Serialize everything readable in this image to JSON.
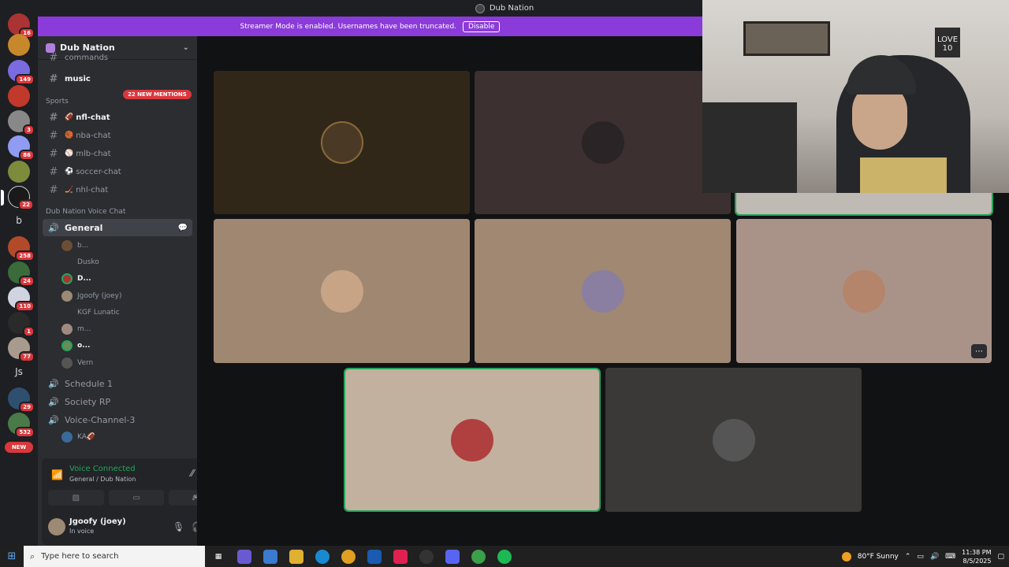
{
  "window": {
    "title": "Dub Nation"
  },
  "banner": {
    "text": "Streamer Mode is enabled. Usernames have been truncated.",
    "disable_label": "Disable"
  },
  "guilds": [
    {
      "badge": "16"
    },
    {
      "badge": ""
    },
    {
      "badge": "149"
    },
    {
      "badge": ""
    },
    {
      "badge": "3"
    },
    {
      "badge": "86"
    },
    {
      "badge": ""
    },
    {
      "badge": "22"
    },
    {
      "letter": "b"
    },
    {
      "badge": "258"
    },
    {
      "badge": "24"
    },
    {
      "badge": "110"
    },
    {
      "badge": "1"
    },
    {
      "badge": "77"
    },
    {
      "letter": "Js"
    },
    {
      "badge": "29"
    },
    {
      "badge": "532"
    }
  ],
  "new_badge": "NEW",
  "server": {
    "name": "Dub Nation"
  },
  "channels": {
    "partial": "commands",
    "music": "music",
    "mentions": "22 NEW MENTIONS",
    "sports_category": "Sports",
    "sports": [
      {
        "name": "nfl-chat",
        "emoji": "🏈",
        "bold": true
      },
      {
        "name": "nba-chat",
        "emoji": "🏀",
        "bold": false
      },
      {
        "name": "mlb-chat",
        "emoji": "⚾",
        "bold": false
      },
      {
        "name": "soccer-chat",
        "emoji": "⚽",
        "bold": false
      },
      {
        "name": "nhl-chat",
        "emoji": "🏒",
        "bold": false
      }
    ],
    "voice_category": "Dub Nation Voice Chat",
    "general": "General",
    "members": [
      "b...",
      "Dusko",
      "D...",
      "Jgoofy (joey)",
      "KGF Lunatic",
      "m...",
      "o...",
      "Vern"
    ],
    "other_voice": [
      "Schedule 1",
      "Society RP",
      "Voice-Channel-3"
    ],
    "vc3_member": "KA🏈"
  },
  "voice_panel": {
    "status": "Voice Connected",
    "sub": "General / Dub Nation",
    "username": "Jgoofy (joey)",
    "user_status": "In voice"
  },
  "webcam": {
    "poster_text": "LOVE 10"
  },
  "taskbar": {
    "search_placeholder": "Type here to search",
    "weather": "80°F  Sunny",
    "time": "11:38 PM",
    "date": "8/5/2025"
  },
  "colors": {
    "accent": "#8b3bd9",
    "speaking": "#23a55a",
    "mention": "#da373c"
  }
}
